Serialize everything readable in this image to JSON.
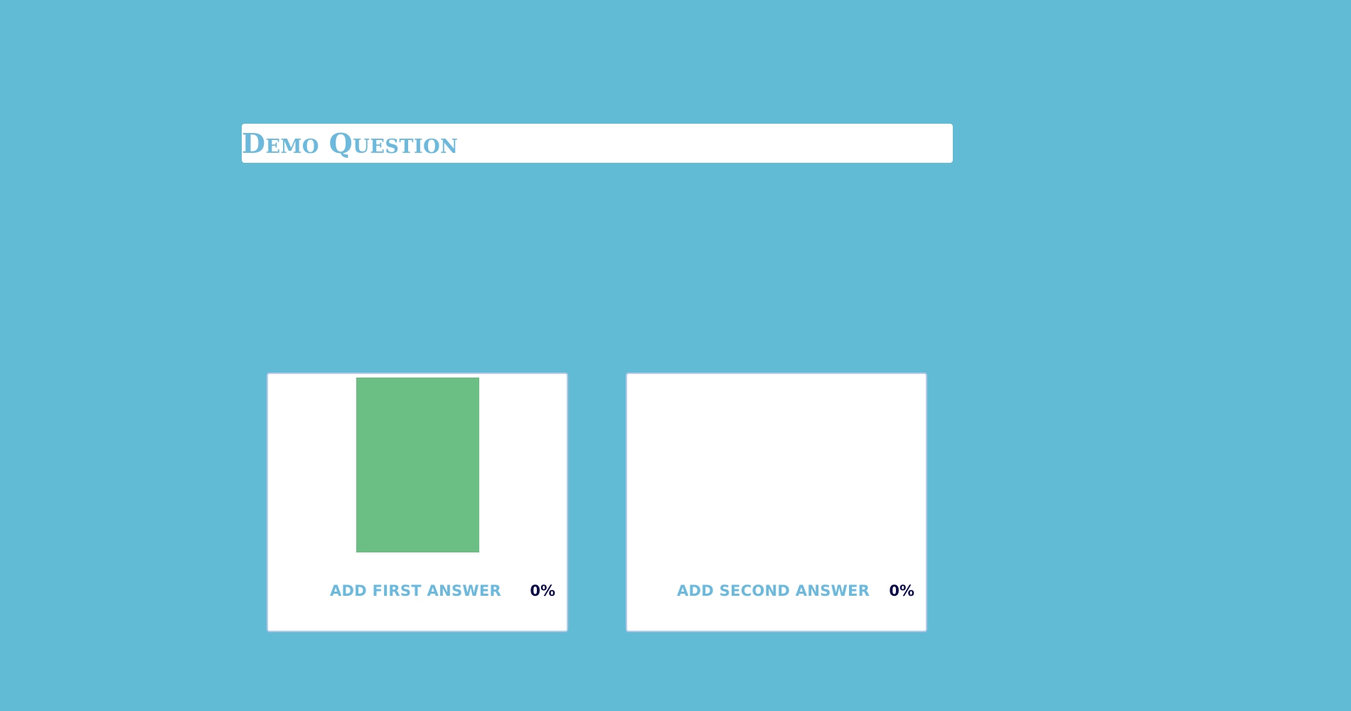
{
  "question": {
    "title": "Demo Question"
  },
  "answers": [
    {
      "label": "Add first answer",
      "percent_text": "0%",
      "bar_fill": 1.0,
      "bar_color": "#6cbf84"
    },
    {
      "label": "Add second answer",
      "percent_text": "0%",
      "bar_fill": 0.0,
      "bar_color": "#6cbf84"
    }
  ],
  "colors": {
    "background": "#62bbd5",
    "accent_text": "#6bb9dd",
    "percent_text": "#0a0a4a",
    "card_border": "#b8c8ea"
  }
}
